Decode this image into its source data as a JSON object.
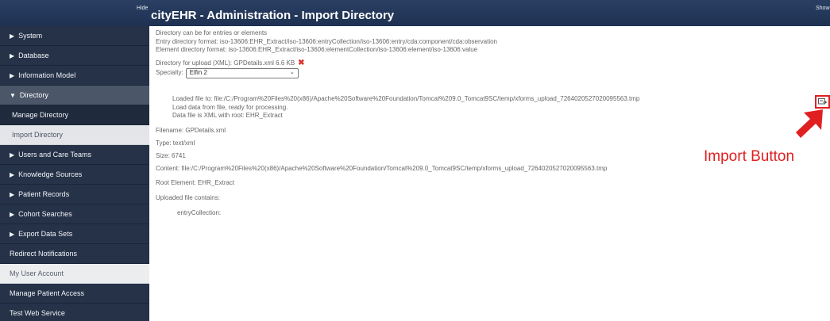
{
  "header": {
    "hide_label": "Hide",
    "title": "cityEHR - Administration - Import Directory",
    "show_label": "Show"
  },
  "sidebar": {
    "items": [
      {
        "label": "System",
        "expander": "▶"
      },
      {
        "label": "Database",
        "expander": "▶"
      },
      {
        "label": "Information Model",
        "expander": "▶"
      },
      {
        "label": "Directory",
        "expander": "▼"
      },
      {
        "label": "Manage Directory"
      },
      {
        "label": "Import Directory"
      },
      {
        "label": "Users and Care Teams",
        "expander": "▶"
      },
      {
        "label": "Knowledge Sources",
        "expander": "▶"
      },
      {
        "label": "Patient Records",
        "expander": "▶"
      },
      {
        "label": "Cohort Searches",
        "expander": "▶"
      },
      {
        "label": "Export Data Sets",
        "expander": "▶"
      },
      {
        "label": "Redirect Notifications"
      },
      {
        "label": "My User Account"
      },
      {
        "label": "Manage Patient Access"
      },
      {
        "label": "Test Web Service"
      }
    ]
  },
  "main": {
    "info_lines": [
      "Directory can be for entries or elements",
      "Entry directory format: iso-13606:EHR_Extract/iso-13606:entryCollection/iso-13606:entry/cda:component/cda:observation",
      "Element directory format: iso-13606:EHR_Extract/iso-13606:elementCollection/iso-13606:element/iso-13606:value"
    ],
    "upload_text": "Directory for upload (XML): GPDetails.xml  6.6 KB",
    "remove_icon": "✖",
    "specialty_label": "Specialty:",
    "specialty_value": "Elfin 2",
    "load_messages": [
      "Loaded file to: file:/C:/Program%20Files%20(x86)/Apache%20Software%20Foundation/Tomcat%209.0_Tomcat9SC/temp/xforms_upload_7264020527020095563.tmp",
      "Load data from file, ready for processing.",
      "Data file is XML with root: EHR_Extract"
    ],
    "file_info": {
      "filename": "Filename: GPDetails.xml",
      "type": "Type: text/xml",
      "size": "Size: 6741",
      "content": "Content: file:/C:/Program%20Files%20(x86)/Apache%20Software%20Foundation/Tomcat%209.0_Tomcat9SC/temp/xforms_upload_7264020527020095563.tmp"
    },
    "root_element": "Root Element: EHR_Extract",
    "uploaded_contains": "Uploaded file contains:",
    "entry_collection": "entryCollection:"
  },
  "import_button": {
    "icon": "import-icon"
  },
  "annotation": {
    "label": "Import Button",
    "color": "#e02020"
  }
}
